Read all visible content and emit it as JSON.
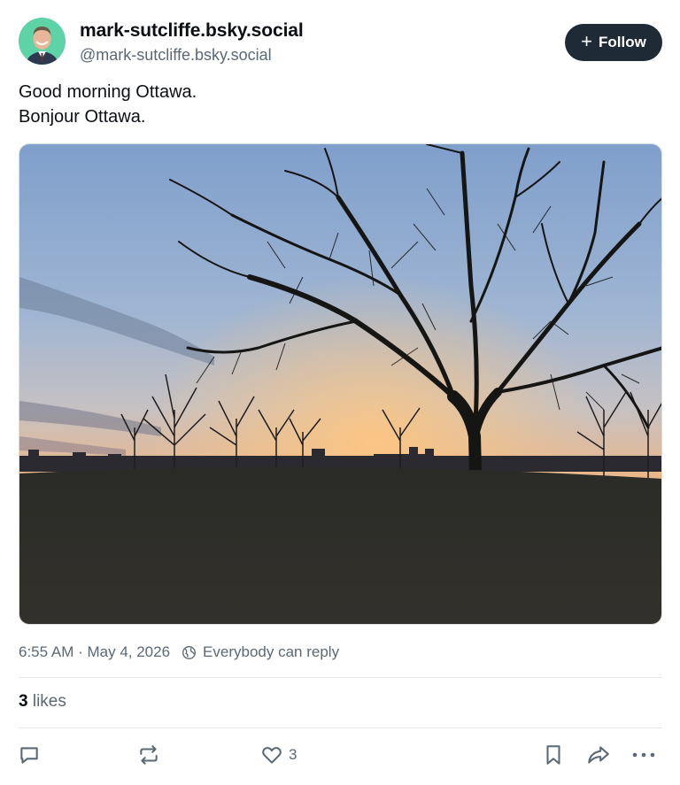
{
  "author": {
    "display_name": "mark-sutcliffe.bsky.social",
    "handle": "@mark-sutcliffe.bsky.social"
  },
  "follow_button": {
    "label": "Follow",
    "icon": "plus-icon"
  },
  "post": {
    "lines": [
      "Good morning Ottawa.",
      "Bonjour Ottawa."
    ]
  },
  "meta": {
    "timestamp": "6:55 AM · May 4, 2026",
    "reply_setting": "Everybody can reply"
  },
  "likes": {
    "count": "3",
    "label": "likes"
  },
  "actions": {
    "reply_icon": "speech-bubble-icon",
    "repost_icon": "repost-icon",
    "like_icon": "heart-icon",
    "like_count": "3",
    "bookmark_icon": "bookmark-icon",
    "share_icon": "share-arrow-icon",
    "more_icon": "ellipsis-icon"
  },
  "colors": {
    "follow_bg": "#1e2a36",
    "text_primary": "#0b0f14",
    "text_secondary": "#5b6875",
    "avatar_bg": "#5fd3a8"
  }
}
